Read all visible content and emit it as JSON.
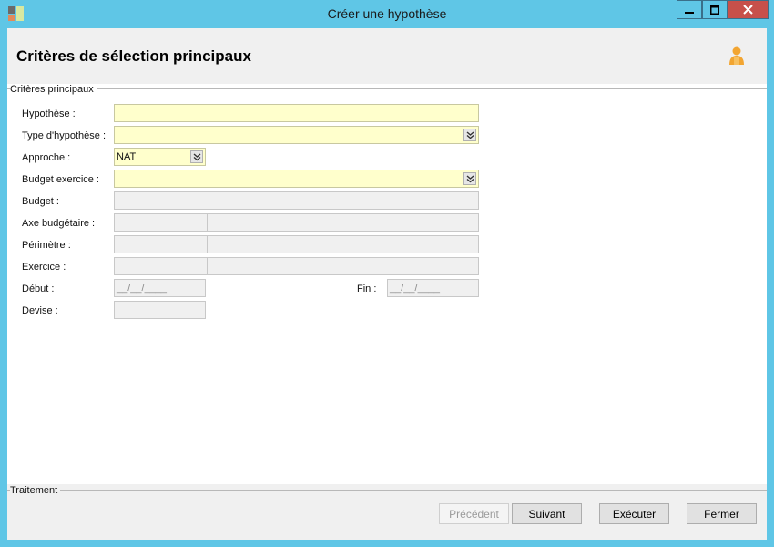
{
  "window": {
    "title": "Créer une hypothèse"
  },
  "header": {
    "title": "Critères de sélection principaux"
  },
  "criteria_group": {
    "label": "Critères principaux",
    "fields": {
      "hypothese": {
        "label": "Hypothèse :",
        "value": ""
      },
      "type_hypothese": {
        "label": "Type d'hypothèse :",
        "value": ""
      },
      "approche": {
        "label": "Approche :",
        "value": "NAT"
      },
      "budget_exercice": {
        "label": "Budget exercice :",
        "value": ""
      },
      "budget": {
        "label": "Budget :",
        "value": ""
      },
      "axe_budgetaire": {
        "label": "Axe budgétaire :",
        "code": "",
        "description": ""
      },
      "perimetre": {
        "label": "Périmètre :",
        "code": "",
        "description": ""
      },
      "exercice": {
        "label": "Exercice :",
        "code": "",
        "description": ""
      },
      "debut": {
        "label": "Début :",
        "placeholder": "__/__/____"
      },
      "fin": {
        "label": "Fin :",
        "placeholder": "__/__/____"
      },
      "devise": {
        "label": "Devise :",
        "value": ""
      }
    }
  },
  "traitement_group": {
    "label": "Traitement",
    "buttons": {
      "precedent": "Précédent",
      "suivant": "Suivant",
      "executer": "Exécuter",
      "fermer": "Fermer"
    },
    "precedent_enabled": false
  },
  "colors": {
    "title_bar": "#5fc6e6",
    "required_field": "#ffffcc",
    "disabled_field": "#f0f0f0",
    "close_button": "#c7504a"
  },
  "icons": [
    "app-icon",
    "minimize-icon",
    "maximize-icon",
    "close-icon",
    "user-icon",
    "chevron-down-icon"
  ]
}
